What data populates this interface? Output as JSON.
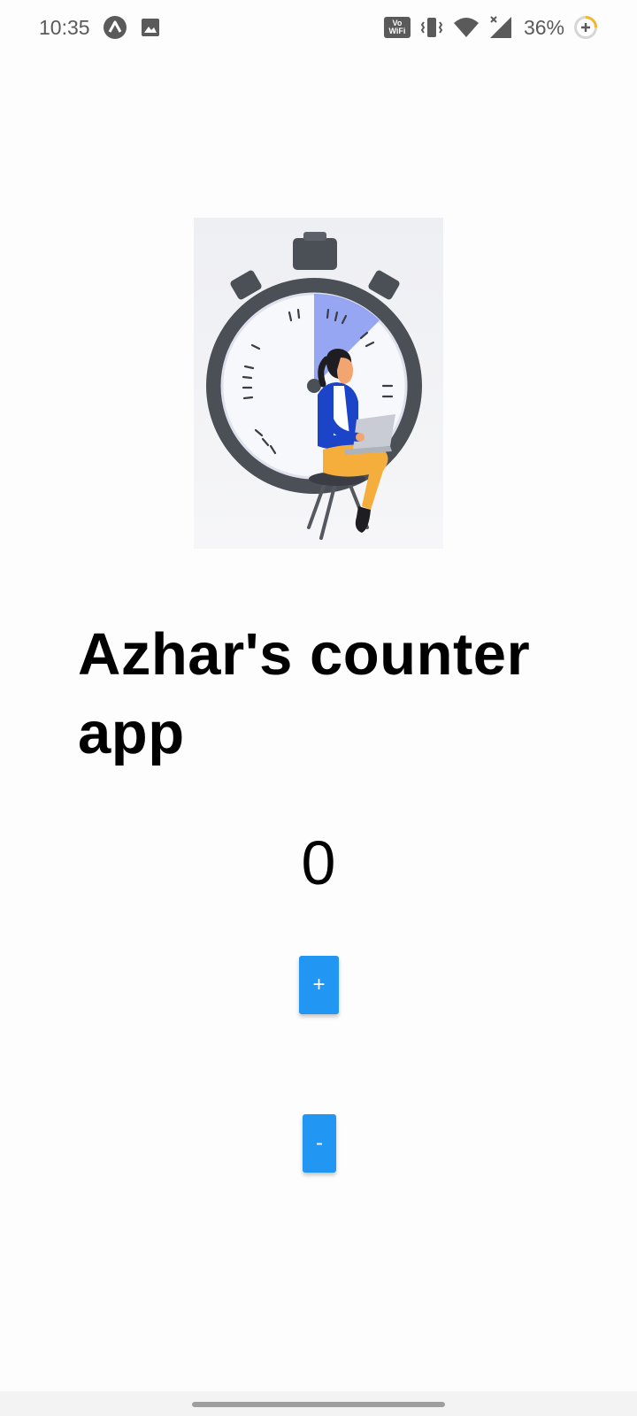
{
  "status_bar": {
    "time": "10:35",
    "battery": "36%",
    "icons": [
      "app-notification-icon",
      "image-notification-icon",
      "vowifi-icon",
      "vibrate-icon",
      "wifi-icon",
      "cell-signal-icon",
      "battery-saver-icon"
    ],
    "vowifi_top": "Vo",
    "vowifi_bottom": "WiFi"
  },
  "app": {
    "title": "Azhar's counter app",
    "counter_value": "0",
    "increment_label": "+",
    "decrement_label": "-"
  },
  "colors": {
    "button": "#2196f3",
    "illustration_accent": "#1c44c9",
    "illustration_pants": "#f5ad3b"
  }
}
